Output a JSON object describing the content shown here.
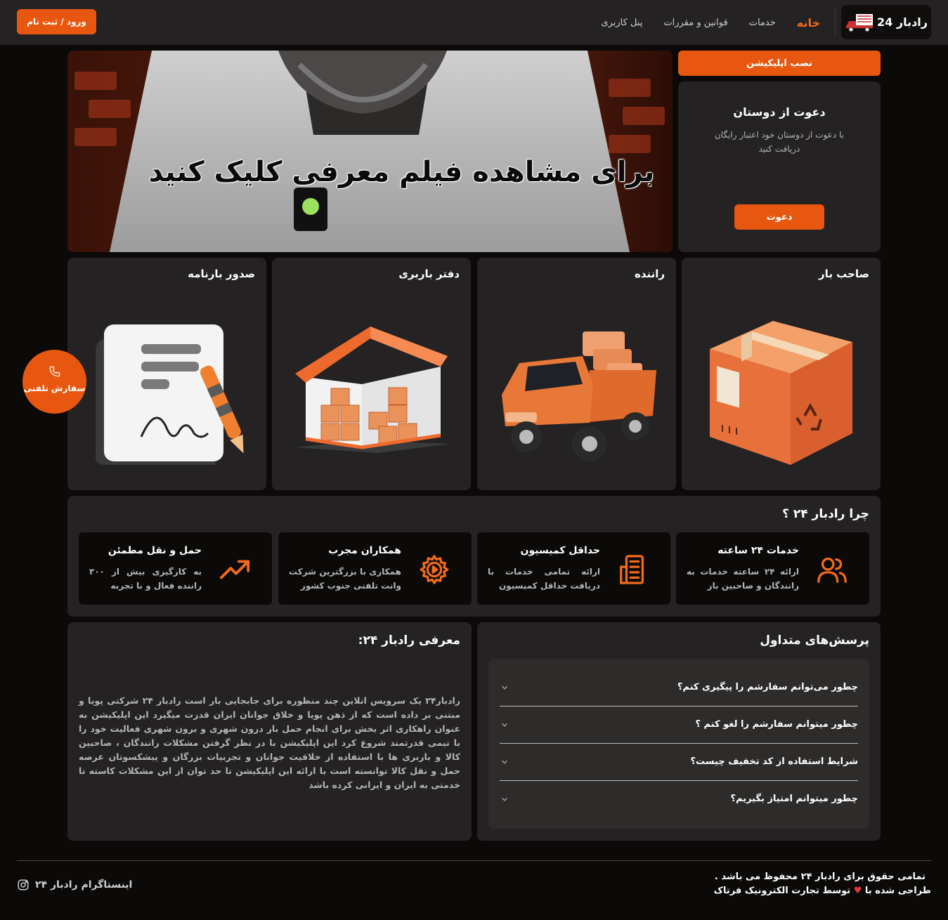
{
  "header": {
    "logo_text": "رادبار 24",
    "nav": [
      "خانه",
      "خدمات",
      "قوانین و مقررات",
      "پنل کاربری"
    ],
    "login_label": "ورود / ثبت نام"
  },
  "hero": {
    "video_caption": "برای مشاهده فیلم معرفی کلیک کنید",
    "install_label": "نصب اپلیکیشن",
    "invite_title": "دعوت از دوستان",
    "invite_desc": "با دعوت از دوستان خود اعتبار رایگان دریافت کنید",
    "invite_button": "دعوت"
  },
  "services": [
    "صاحب بار",
    "راننده",
    "دفتر باربری",
    "صدور بارنامه"
  ],
  "call_float": {
    "label": "سفارش تلفنی"
  },
  "why": {
    "title": "چرا رادبار ۲۴ ؟",
    "features": [
      {
        "title": "خدمات ۲۴ ساعته",
        "desc": "ارائه ۲۴ ساعته خدمات به رانندگان و صاحبین بار"
      },
      {
        "title": "حداقل کمیسیون",
        "desc": "ارائه تمامی خدمات با دریافت حداقل کمیسیون"
      },
      {
        "title": "همکاران مجرب",
        "desc": "همکاری با بزرگترین شرکت وانت تلفنی جنوب کشور"
      },
      {
        "title": "حمل و نقل مطمئن",
        "desc": "به کارگیری بیش از ۳۰۰ راننده فعال و با تجربه"
      }
    ]
  },
  "faq": {
    "title": "پرسش‌های متداول",
    "items": [
      "چطور می‌توانم سفارشم را پیگیری کنم؟",
      "چطور میتوانم سفارشم را لغو کنم ؟",
      "شرایط استفاده از کد تخفیف چیست؟",
      "چطور میتوانم امتیاز بگیریم؟"
    ]
  },
  "intro": {
    "title": "معرفی رادبار ۲۴:",
    "text": "رادبار۲۴ یک سرویس انلاین چند منظوره برای جابجایی بار است رادبار ۲۴ شرکتی پویا و مبتنی بر داده است که از ذهن پویا و خلاق جوانان ایران قدرت میگیرد این اپلیکیشن به عنوان راهکاری اثر بخش برای انجام حمل بار درون شهری و برون شهری فعالیت خود را با تیمی قدرتمند شروع کرد این اپلیکیشن با در نظر گرفتن مشکلات رانندگان ، صاحبین کالا و باربری ها با استفاده از خلاقیت جوانان و تجربیات بزرگان و پیشکسوتان عرصه حمل و نقل کالا توانسته است با ارائه این اپلیکیشن تا حد توان از این مشکلات کاسته تا خدمتی به ایران و ایرانی کرده باشد"
  },
  "footer": {
    "copyright": "تمامی حقوق برای رادبار ۲۴ محفوظ می باشد .",
    "designed_prefix": "طراحی شده با",
    "designed_suffix": "توسط تجارت الکترونیک فرتاک",
    "instagram": "اینستاگرام رادبار ۲۴"
  },
  "colors": {
    "accent": "#e8570f",
    "card": "#242222",
    "background": "#0b0a09"
  }
}
